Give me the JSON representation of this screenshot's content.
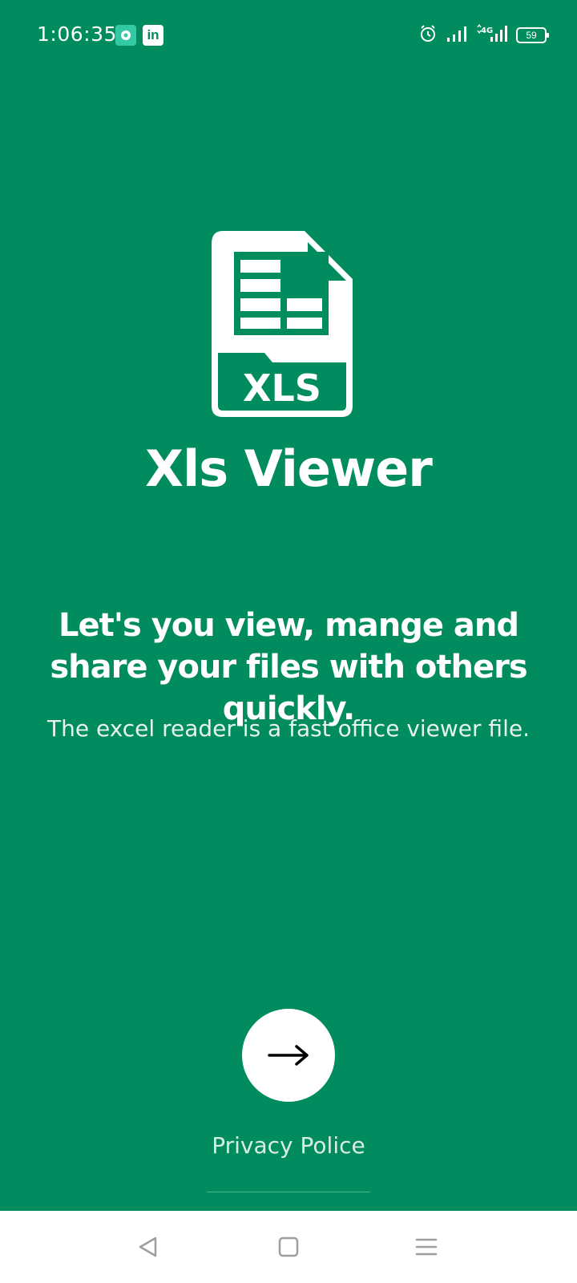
{
  "status_bar": {
    "time": "1:06:35",
    "battery_level": "59",
    "network": "4G",
    "icons": [
      "music-app-icon",
      "linkedin-icon",
      "alarm-icon",
      "signal-icon",
      "signal-4g-icon",
      "battery-icon"
    ]
  },
  "app": {
    "logo_label": "XLS",
    "title": "Xls Viewer",
    "headline": "Let's you view, mange and share your files with others quickly.",
    "subtext": "The excel reader is a fast office viewer file.",
    "next_icon": "arrow-right-icon",
    "privacy_link": "Privacy Police"
  },
  "navigation_bar": {
    "buttons": [
      "back-icon",
      "home-icon",
      "menu-icon"
    ]
  },
  "colors": {
    "background": "#008c5f",
    "foreground": "#ffffff",
    "nav_background": "#ffffff",
    "nav_icon": "#9e9e9e"
  }
}
